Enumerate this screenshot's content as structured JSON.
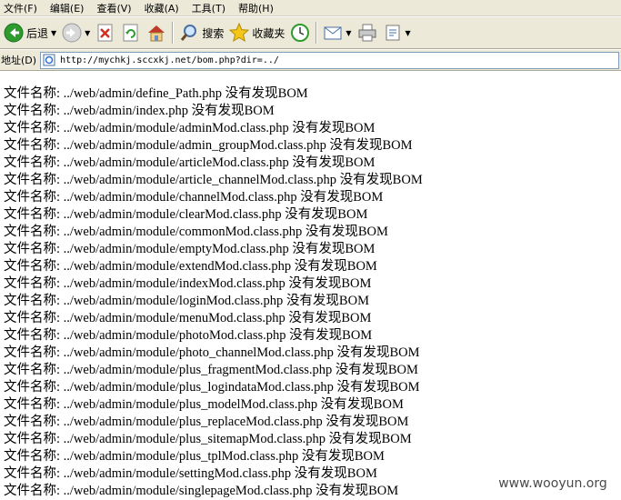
{
  "menu": [
    {
      "label": "文件(F)"
    },
    {
      "label": "编辑(E)"
    },
    {
      "label": "查看(V)"
    },
    {
      "label": "收藏(A)"
    },
    {
      "label": "工具(T)"
    },
    {
      "label": "帮助(H)"
    }
  ],
  "toolbar": {
    "back_label": "后退",
    "search_label": "搜索",
    "favorites_label": "收藏夹"
  },
  "address": {
    "label": "地址(D)",
    "url": "http://mychkj.sccxkj.net/bom.php?dir=../"
  },
  "content": {
    "rows": [
      {
        "prefix": "文件名称:",
        "path": "../web/admin/define_Path.php",
        "status": "没有发现BOM"
      },
      {
        "prefix": "文件名称:",
        "path": "../web/admin/index.php",
        "status": "没有发现BOM"
      },
      {
        "prefix": "文件名称:",
        "path": "../web/admin/module/adminMod.class.php",
        "status": "没有发现BOM"
      },
      {
        "prefix": "文件名称:",
        "path": "../web/admin/module/admin_groupMod.class.php",
        "status": "没有发现BOM"
      },
      {
        "prefix": "文件名称:",
        "path": "../web/admin/module/articleMod.class.php",
        "status": "没有发现BOM"
      },
      {
        "prefix": "文件名称:",
        "path": "../web/admin/module/article_channelMod.class.php",
        "status": "没有发现BOM"
      },
      {
        "prefix": "文件名称:",
        "path": "../web/admin/module/channelMod.class.php",
        "status": "没有发现BOM"
      },
      {
        "prefix": "文件名称:",
        "path": "../web/admin/module/clearMod.class.php",
        "status": "没有发现BOM"
      },
      {
        "prefix": "文件名称:",
        "path": "../web/admin/module/commonMod.class.php",
        "status": "没有发现BOM"
      },
      {
        "prefix": "文件名称:",
        "path": "../web/admin/module/emptyMod.class.php",
        "status": "没有发现BOM"
      },
      {
        "prefix": "文件名称:",
        "path": "../web/admin/module/extendMod.class.php",
        "status": "没有发现BOM"
      },
      {
        "prefix": "文件名称:",
        "path": "../web/admin/module/indexMod.class.php",
        "status": "没有发现BOM"
      },
      {
        "prefix": "文件名称:",
        "path": "../web/admin/module/loginMod.class.php",
        "status": "没有发现BOM"
      },
      {
        "prefix": "文件名称:",
        "path": "../web/admin/module/menuMod.class.php",
        "status": "没有发现BOM"
      },
      {
        "prefix": "文件名称:",
        "path": "../web/admin/module/photoMod.class.php",
        "status": "没有发现BOM"
      },
      {
        "prefix": "文件名称:",
        "path": "../web/admin/module/photo_channelMod.class.php",
        "status": "没有发现BOM"
      },
      {
        "prefix": "文件名称:",
        "path": "../web/admin/module/plus_fragmentMod.class.php",
        "status": "没有发现BOM"
      },
      {
        "prefix": "文件名称:",
        "path": "../web/admin/module/plus_logindataMod.class.php",
        "status": "没有发现BOM"
      },
      {
        "prefix": "文件名称:",
        "path": "../web/admin/module/plus_modelMod.class.php",
        "status": "没有发现BOM"
      },
      {
        "prefix": "文件名称:",
        "path": "../web/admin/module/plus_replaceMod.class.php",
        "status": "没有发现BOM"
      },
      {
        "prefix": "文件名称:",
        "path": "../web/admin/module/plus_sitemapMod.class.php",
        "status": "没有发现BOM"
      },
      {
        "prefix": "文件名称:",
        "path": "../web/admin/module/plus_tplMod.class.php",
        "status": "没有发现BOM"
      },
      {
        "prefix": "文件名称:",
        "path": "../web/admin/module/settingMod.class.php",
        "status": "没有发现BOM"
      },
      {
        "prefix": "文件名称:",
        "path": "../web/admin/module/singlepageMod.class.php",
        "status": "没有发现BOM"
      }
    ]
  },
  "watermark": {
    "text": "www.wooyun.org"
  },
  "colors": {
    "chrome": "#ece9d8",
    "back_green": "#2e9b2e",
    "stop_red": "#d03020"
  }
}
